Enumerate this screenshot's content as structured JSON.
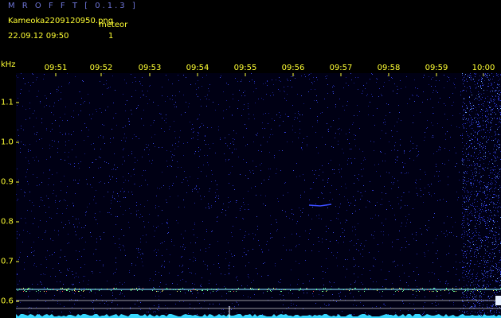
{
  "header": {
    "app_title": "M R O F F T  [ 0.1.3 ]",
    "filename": "Kameoka2209120950.png",
    "datetime": "22.09.12 09:50",
    "meteor_label": "meteor",
    "meteor_count": "1"
  },
  "axes": {
    "y_unit": "kHz",
    "time_labels": [
      "09:51",
      "09:52",
      "09:53",
      "09:54",
      "09:55",
      "09:56",
      "09:57",
      "09:58",
      "09:59",
      "10:00"
    ],
    "freq_labels": [
      "1.1",
      "1.0",
      "0.9",
      "0.8",
      "0.7",
      "0.6"
    ]
  },
  "colors": {
    "background": "#000000",
    "spectrogram_bg": "#000014",
    "text": "#ffff33",
    "title": "#6d74d6",
    "noise_dot": "#2a32c8",
    "carrier_line": "#7fdcff",
    "baseline": "#ffffff"
  }
}
